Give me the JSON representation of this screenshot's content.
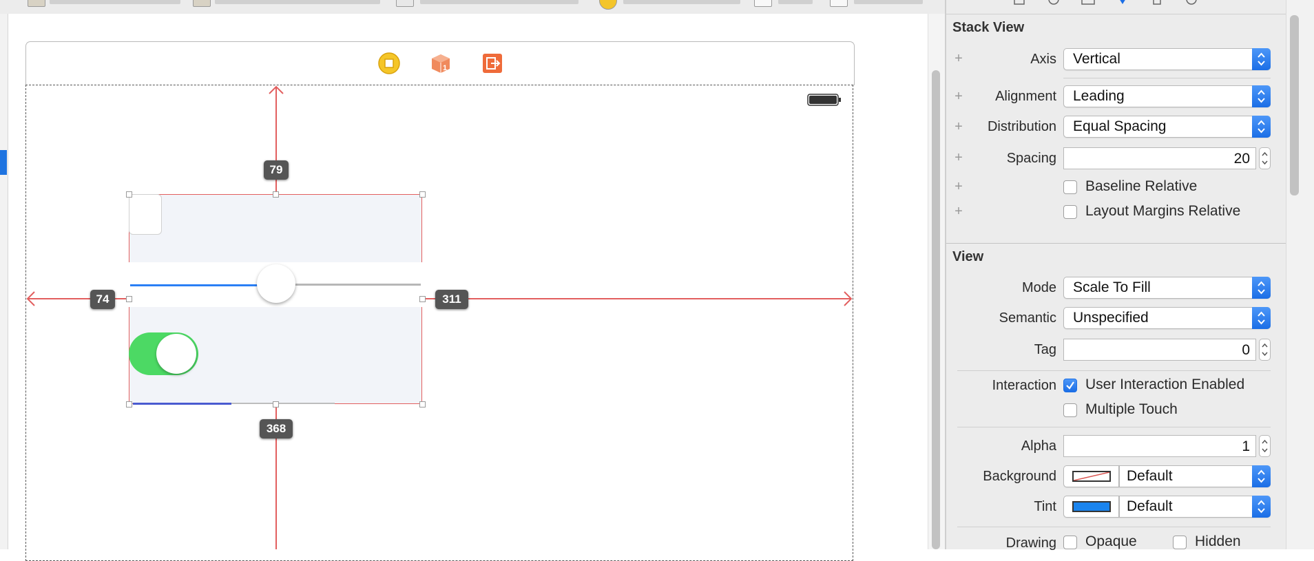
{
  "inspector": {
    "stack_view": {
      "section_title": "Stack View",
      "axis": {
        "label": "Axis",
        "value": "Vertical"
      },
      "alignment": {
        "label": "Alignment",
        "value": "Leading"
      },
      "distribution": {
        "label": "Distribution",
        "value": "Equal Spacing"
      },
      "spacing": {
        "label": "Spacing",
        "value": "20"
      },
      "baseline_relative": {
        "label": "Baseline Relative",
        "checked": false
      },
      "layout_margins_relative": {
        "label": "Layout Margins Relative",
        "checked": false
      }
    },
    "view": {
      "section_title": "View",
      "mode": {
        "label": "Mode",
        "value": "Scale To Fill"
      },
      "semantic": {
        "label": "Semantic",
        "value": "Unspecified"
      },
      "tag": {
        "label": "Tag",
        "value": "0"
      },
      "interaction_label": "Interaction",
      "user_interaction_enabled": {
        "label": "User Interaction Enabled",
        "checked": true
      },
      "multiple_touch": {
        "label": "Multiple Touch",
        "checked": false
      },
      "alpha": {
        "label": "Alpha",
        "value": "1"
      },
      "background": {
        "label": "Background",
        "value": "Default",
        "swatch": "none"
      },
      "tint": {
        "label": "Tint",
        "value": "Default",
        "swatch": "#1a84ee"
      },
      "drawing_label": "Drawing",
      "opaque": {
        "label": "Opaque",
        "checked": false
      },
      "hidden": {
        "label": "Hidden",
        "checked": false
      }
    }
  },
  "canvas": {
    "constraints": {
      "top": "79",
      "leading": "74",
      "trailing": "311",
      "bottom": "368"
    },
    "slider_value_fraction": 0.5,
    "progress_fraction": 0.49,
    "toggle_on": true
  },
  "colors": {
    "accent": "#1b6ee6",
    "constraint_line": "#e25e5e",
    "toggle_on": "#4cd964",
    "badge_bg": "#555555"
  },
  "icons": {
    "dock": [
      "view-controller-icon",
      "first-responder-icon",
      "exit-icon"
    ],
    "status_bar": "battery-icon"
  }
}
